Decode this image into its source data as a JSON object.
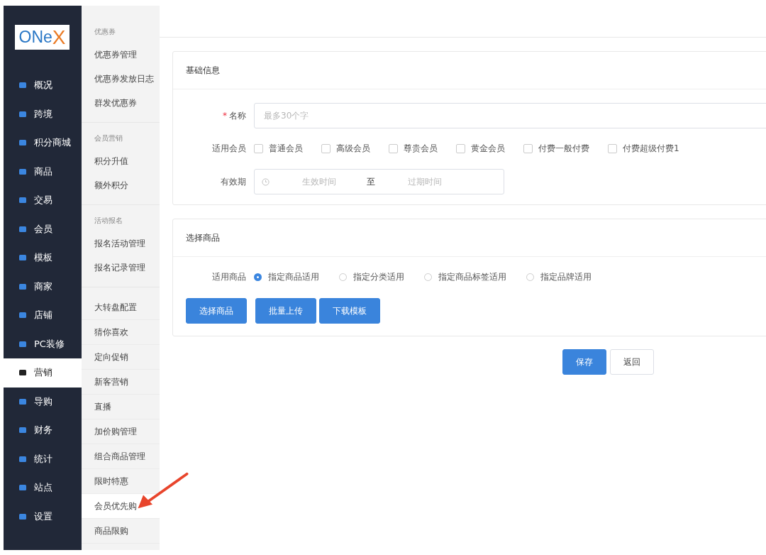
{
  "logo": {
    "part_1": "ONe",
    "part_2": "X"
  },
  "sidebar": {
    "items": [
      {
        "label": "概况",
        "selected": false
      },
      {
        "label": "跨境",
        "selected": false
      },
      {
        "label": "积分商城",
        "selected": false
      },
      {
        "label": "商品",
        "selected": false
      },
      {
        "label": "交易",
        "selected": false
      },
      {
        "label": "会员",
        "selected": false
      },
      {
        "label": "模板",
        "selected": false
      },
      {
        "label": "商家",
        "selected": false
      },
      {
        "label": "店铺",
        "selected": false
      },
      {
        "label": "PC装修",
        "selected": false
      },
      {
        "label": "营销",
        "selected": true
      },
      {
        "label": "导购",
        "selected": false
      },
      {
        "label": "财务",
        "selected": false
      },
      {
        "label": "统计",
        "selected": false
      },
      {
        "label": "站点",
        "selected": false
      },
      {
        "label": "设置",
        "selected": false
      }
    ]
  },
  "submenu": {
    "groups": [
      {
        "heading": "优惠券",
        "items": [
          {
            "label": "优惠券管理",
            "selected": false
          },
          {
            "label": "优惠券发放日志",
            "selected": false
          },
          {
            "label": "群发优惠券",
            "selected": false
          }
        ]
      },
      {
        "heading": "会员营销",
        "items": [
          {
            "label": "积分升值",
            "selected": false
          },
          {
            "label": "额外积分",
            "selected": false
          }
        ]
      },
      {
        "heading": "活动报名",
        "items": [
          {
            "label": "报名活动管理",
            "selected": false
          },
          {
            "label": "报名记录管理",
            "selected": false
          }
        ]
      },
      {
        "items": [
          {
            "label": "大转盘配置",
            "selected": false
          },
          {
            "label": "猜你喜欢",
            "selected": false
          },
          {
            "label": "定向促销",
            "selected": false
          },
          {
            "label": "新客营销",
            "selected": false
          },
          {
            "label": "直播",
            "selected": false
          },
          {
            "label": "加价购管理",
            "selected": false
          },
          {
            "label": "组合商品管理",
            "selected": false
          },
          {
            "label": "限时特惠",
            "selected": false
          },
          {
            "label": "会员优先购",
            "selected": true
          },
          {
            "label": "商品限购",
            "selected": false
          }
        ]
      }
    ]
  },
  "basic_info": {
    "title": "基础信息",
    "name_field": {
      "required_mark": "*",
      "label": "名称",
      "placeholder": "最多30个字"
    },
    "members": {
      "label": "适用会员",
      "options": [
        {
          "label": "普通会员",
          "checked": false
        },
        {
          "label": "高级会员",
          "checked": false
        },
        {
          "label": "尊贵会员",
          "checked": false
        },
        {
          "label": "黄金会员",
          "checked": false
        },
        {
          "label": "付费一般付费",
          "checked": false
        },
        {
          "label": "付费超级付费1",
          "checked": false
        }
      ]
    },
    "validity": {
      "label": "有效期",
      "start_placeholder": "生效时间",
      "separator": "至",
      "end_placeholder": "过期时间"
    }
  },
  "products": {
    "title": "选择商品",
    "scope": {
      "label": "适用商品",
      "options": [
        {
          "label": "指定商品适用",
          "selected": true
        },
        {
          "label": "指定分类适用",
          "selected": false
        },
        {
          "label": "指定商品标签适用",
          "selected": false
        },
        {
          "label": "指定品牌适用",
          "selected": false
        }
      ]
    },
    "buttons": [
      "选择商品",
      "批量上传",
      "下载模板"
    ]
  },
  "actions": [
    {
      "label": "保存",
      "kind": "primary"
    },
    {
      "label": "返回",
      "kind": "plain"
    }
  ]
}
